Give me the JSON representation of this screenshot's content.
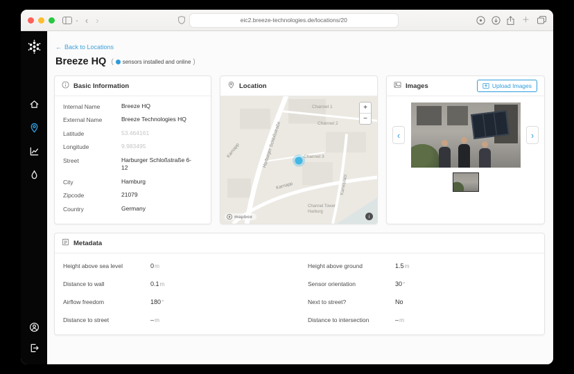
{
  "theme": {
    "accent": "#2D9CDB",
    "marker_blue": "#41B7E6",
    "traffic_close": "#FF5F57",
    "traffic_minimize": "#FEBC2E",
    "traffic_zoom": "#28C840"
  },
  "icons": {
    "back_arrow": "←",
    "browser_back": "‹",
    "browser_forward": "›",
    "chevron_left": "‹",
    "chevron_right": "›",
    "plus": "＋",
    "zoom_in": "+",
    "zoom_out": "−",
    "info_i": "i",
    "chevron_mini": "⌄"
  },
  "browser": {
    "url": "eic2.breeze-technologies.de/locations/20"
  },
  "sidebar": {
    "items": [
      "home",
      "locations",
      "analytics",
      "air-quality"
    ],
    "bottom": [
      "account",
      "logout"
    ]
  },
  "page": {
    "back_label": "Back to Locations",
    "title": "Breeze HQ",
    "status_open": "(",
    "status_text": "sensors installed and online",
    "status_close": ")"
  },
  "basic_info": {
    "title": "Basic Information",
    "rows": [
      {
        "label": "Internal Name",
        "value": "Breeze HQ"
      },
      {
        "label": "External Name",
        "value": "Breeze Technologies HQ"
      },
      {
        "label": "Latitude",
        "value": "53.464161"
      },
      {
        "label": "Longitude",
        "value": "9.983495"
      },
      {
        "label": "Street",
        "value": "Harburger Schloßstraße 6-12"
      },
      {
        "label": "City",
        "value": "Hamburg"
      },
      {
        "label": "Zipcode",
        "value": "21079"
      },
      {
        "label": "Country",
        "value": "Germany"
      }
    ]
  },
  "location": {
    "title": "Location",
    "map": {
      "labels": [
        {
          "text": "Channel 1"
        },
        {
          "text": "Channel 2"
        },
        {
          "text": "Channel 3"
        },
        {
          "text": "Harburger Schloßstraße"
        },
        {
          "text": "Karnapp"
        },
        {
          "text": "Karnapp"
        },
        {
          "text": "Kanalplatz"
        },
        {
          "text": "Channel Tower Harburg"
        }
      ],
      "attribution": "mapbox"
    }
  },
  "images": {
    "title": "Images",
    "upload_label": "Upload Images"
  },
  "metadata": {
    "title": "Metadata",
    "rows": [
      {
        "label": "Height above sea level",
        "value": "0",
        "unit": "m"
      },
      {
        "label": "Height above ground",
        "value": "1.5",
        "unit": "m"
      },
      {
        "label": "Distance to wall",
        "value": "0.1",
        "unit": "m"
      },
      {
        "label": "Sensor orientation",
        "value": "30",
        "unit": "°"
      },
      {
        "label": "Airflow freedom",
        "value": "180",
        "unit": "°"
      },
      {
        "label": "Next to street?",
        "value": "No",
        "unit": ""
      },
      {
        "label": "Distance to street",
        "value": "–",
        "unit": "m"
      },
      {
        "label": "Distance to intersection",
        "value": "–",
        "unit": "m"
      }
    ]
  }
}
